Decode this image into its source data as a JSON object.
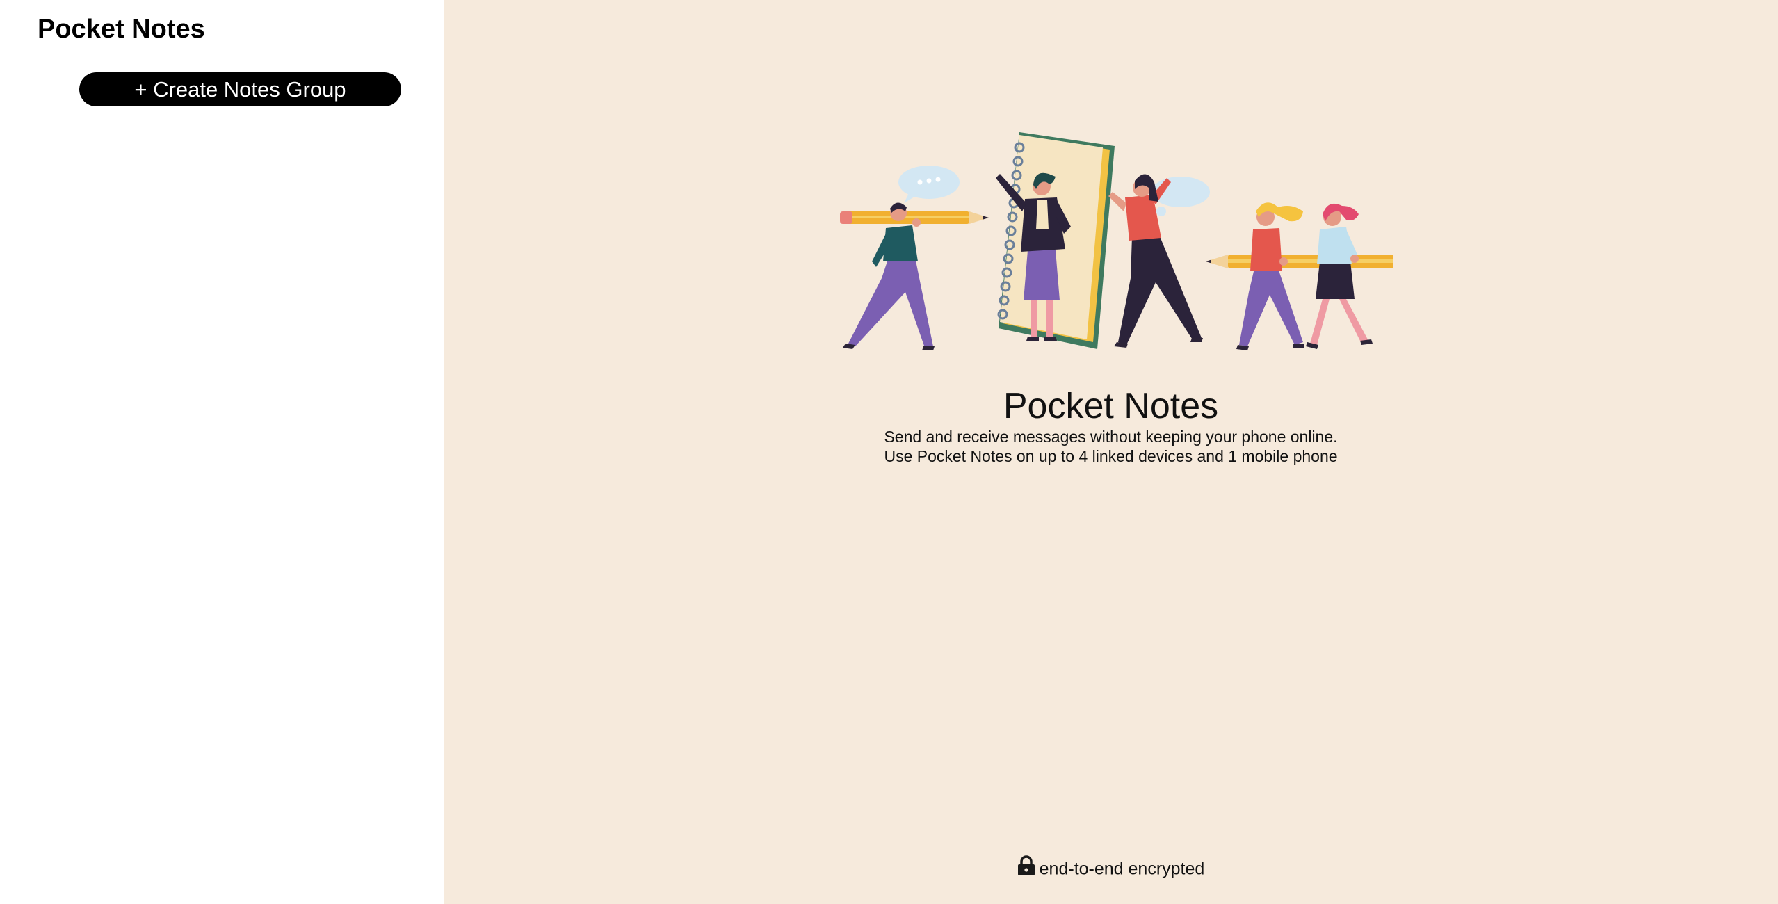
{
  "app": {
    "title": "Pocket Notes"
  },
  "sidebar": {
    "title": "Pocket Notes",
    "create_button_label": "+ Create Notes Group"
  },
  "main": {
    "illustration_icon": "people-with-pencils-and-notebook-illustration",
    "title": "Pocket Notes",
    "description_line1": "Send and receive messages without keeping your phone online.",
    "description_line2": "Use Pocket Notes on up to 4 linked devices and 1 mobile phone",
    "footer_icon": "lock-icon",
    "footer_text": "end-to-end encrypted"
  },
  "colors": {
    "main_background": "#f6eadc",
    "sidebar_background": "#ffffff",
    "button_background": "#000000",
    "button_text": "#ffffff"
  }
}
